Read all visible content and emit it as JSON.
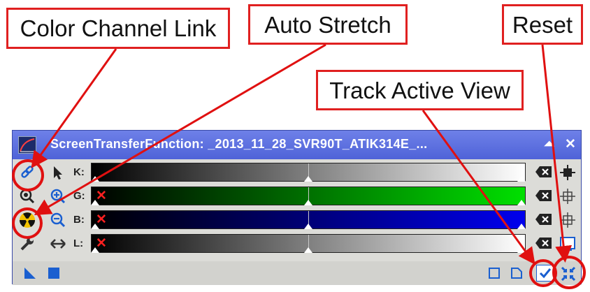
{
  "callouts": {
    "color_channel_link": "Color Channel Link",
    "auto_stretch": "Auto Stretch",
    "track_active_view": "Track Active View",
    "reset": "Reset"
  },
  "window": {
    "title": "ScreenTransferFunction: _2013_11_28_SVR90T_ATIK314E_...",
    "pin_glyph": "⏶",
    "close_glyph": "✕"
  },
  "channels": [
    {
      "label": "K:",
      "gradient_end": "#ffffff",
      "disabled": false
    },
    {
      "label": "G:",
      "gradient_end": "#00e000",
      "disabled": true
    },
    {
      "label": "B:",
      "gradient_end": "#0000ee",
      "disabled": true
    },
    {
      "label": "L:",
      "gradient_end": "#ffffff",
      "disabled": true
    }
  ],
  "disabled_mark": "✕",
  "colors": {
    "highlight": "#e01010",
    "title_bar": "#5a6ddc",
    "accent_blue": "#1a5fd0"
  }
}
